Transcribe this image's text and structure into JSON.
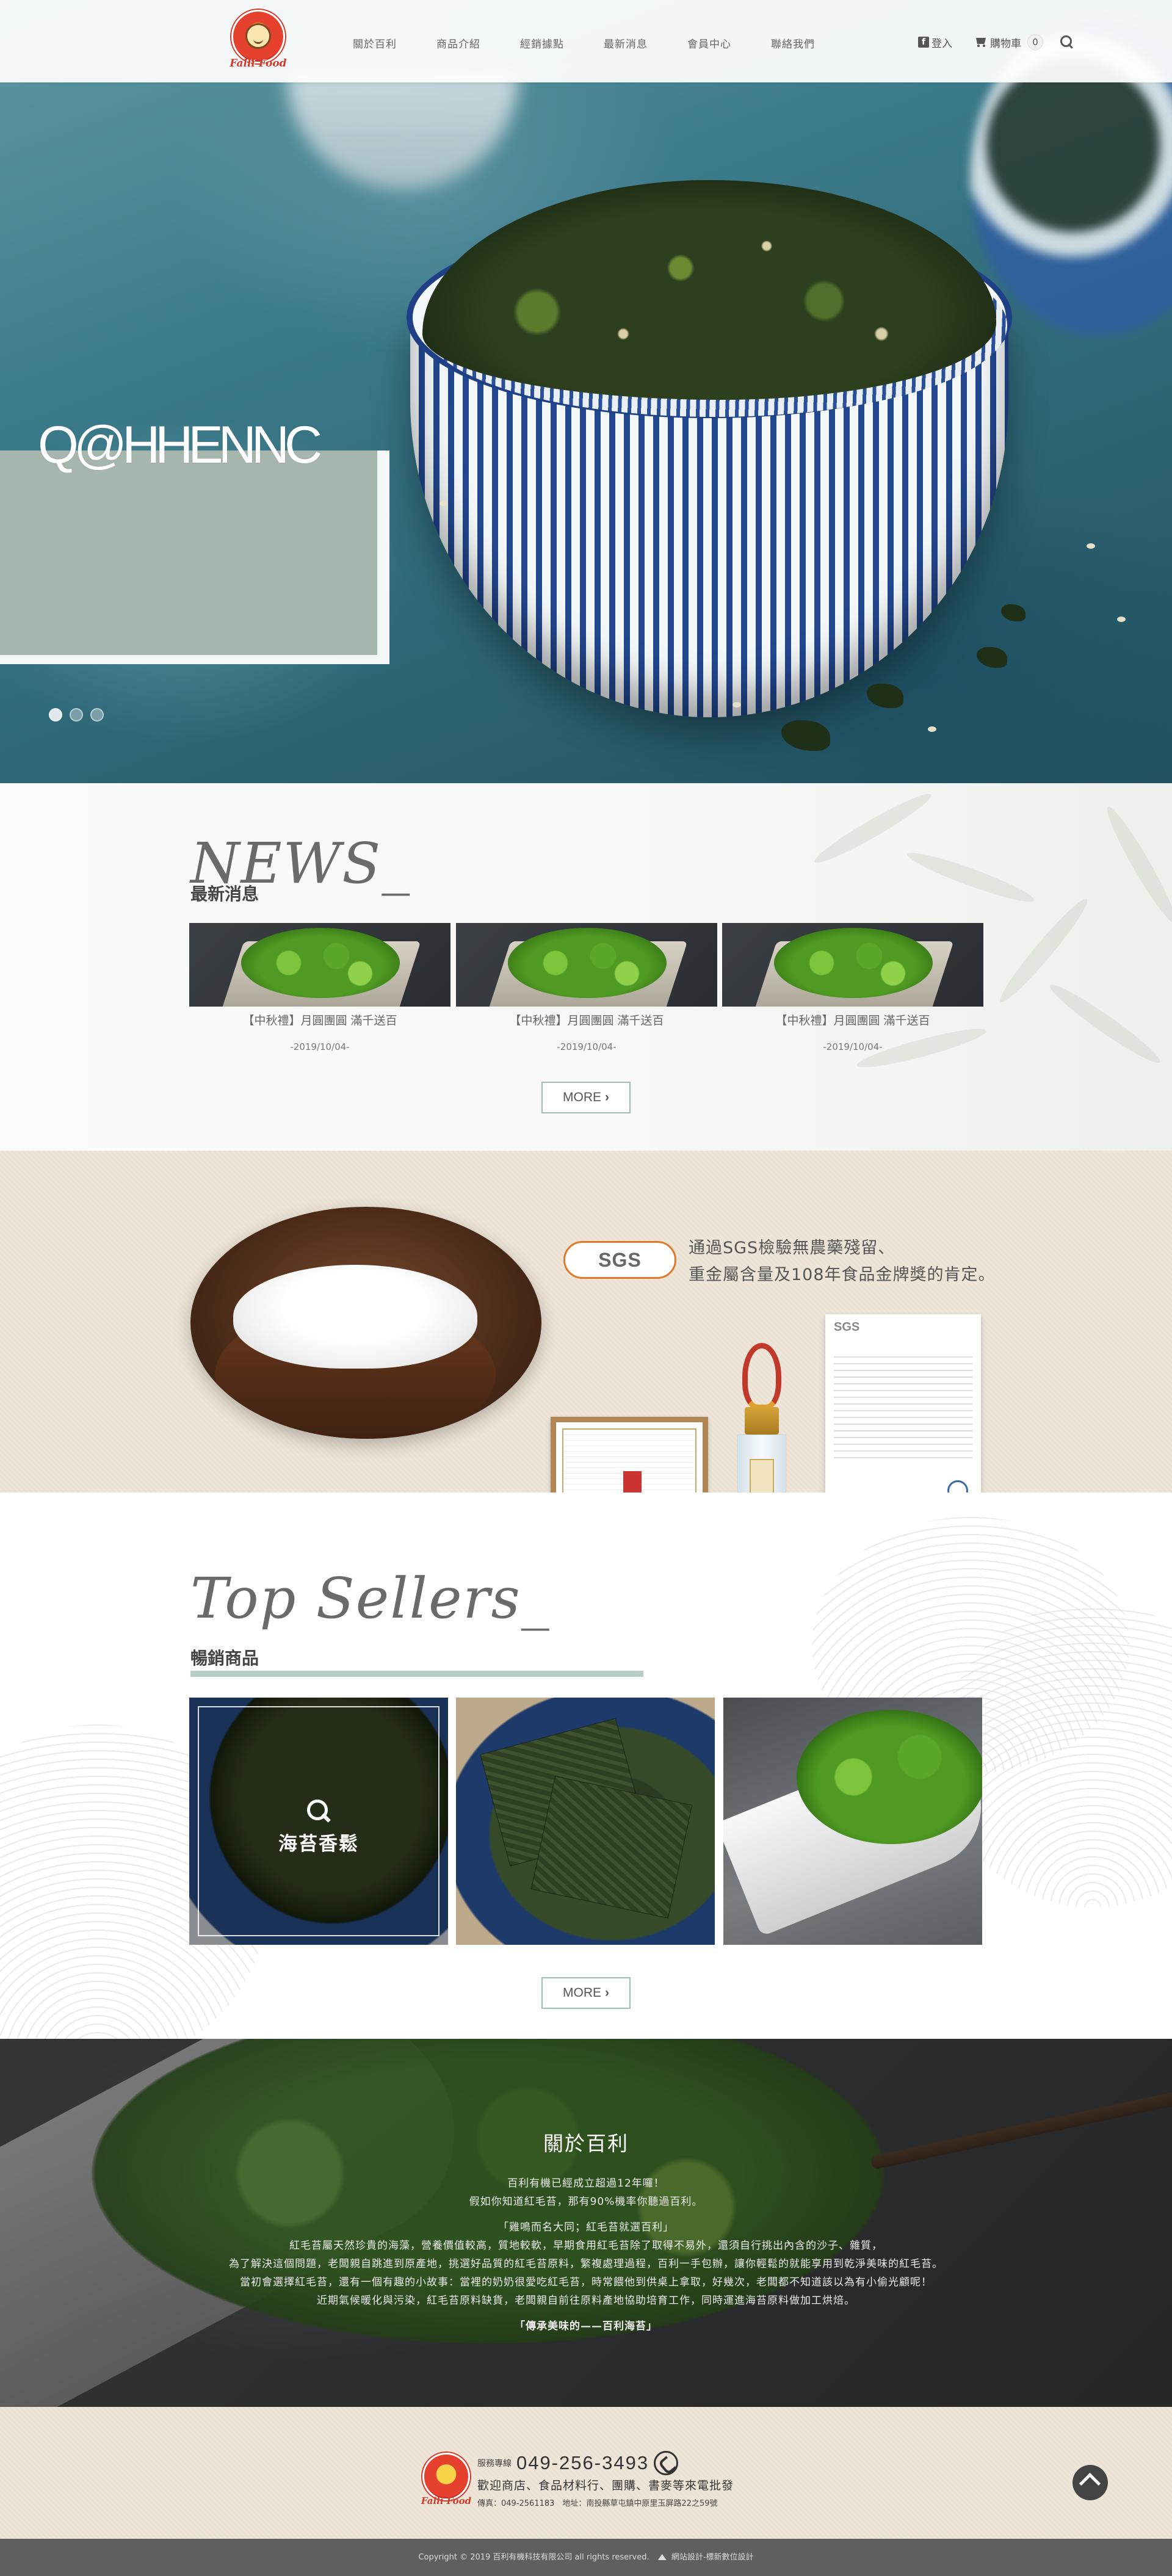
{
  "header": {
    "logo_text": "Falli Food",
    "nav": [
      "關於百利",
      "商品介紹",
      "經銷據點",
      "最新消息",
      "會員中心",
      "聯絡我們"
    ],
    "login_label": "登入",
    "cart_label": "購物車",
    "cart_count": "0",
    "icons": [
      "facebook-icon",
      "cart-icon",
      "search-icon"
    ]
  },
  "hero": {
    "title": "Q@HHENNC",
    "slide_count": 3,
    "active_slide": 1
  },
  "news": {
    "title": "NEWS_",
    "subtitle": "最新消息",
    "items": [
      {
        "caption": "【中秋禮】月圓團圓 滿千送百",
        "date": "-2019/10/04-"
      },
      {
        "caption": "【中秋禮】月圓團圓 滿千送百",
        "date": "-2019/10/04-"
      },
      {
        "caption": "【中秋禮】月圓團圓 滿千送百",
        "date": "-2019/10/04-"
      }
    ],
    "more_label": "MORE"
  },
  "sgs": {
    "badge": "SGS",
    "line1": "通過SGS檢驗無農藥殘留、",
    "line2": "重金屬含量及108年食品金牌獎的肯定。",
    "report_header": "SGS"
  },
  "sellers": {
    "title": "Top Sellers_",
    "subtitle": "暢銷商品",
    "products": [
      {
        "name": "海苔香鬆"
      }
    ],
    "more_label": "MORE"
  },
  "about": {
    "title": "關於百利",
    "p1": "百利有機已經成立超過12年囉！",
    "p2": "假如你知道紅毛苔，那有90%機率你聽過百利。",
    "p3": "「雞鳴而名大同；紅毛苔就選百利」",
    "p4": "紅毛苔屬天然珍貴的海藻，營養價值較高，質地較軟，早期食用紅毛苔除了取得不易外，還須自行挑出內含的沙子、雜質，",
    "p5": "為了解決這個問題，老闆親自跳進到原產地，挑選好品質的紅毛苔原料，繁複處理過程，百利一手包辦，讓你輕鬆的就能享用到乾淨美味的紅毛苔。",
    "p6": "當初會選擇紅毛苔，還有一個有趣的小故事：當裡的奶奶很愛吃紅毛苔，時常餵他到供桌上拿取，好幾次，老闆都不知道該以為有小偷光顧呢！",
    "p7": "近期氣候暖化與污染，紅毛苔原料缺貨，老闆親自前往原料產地協助培育工作，同時運進海苔原料做加工烘焙。",
    "p8": "「傳承美味的——百利海苔」"
  },
  "footer": {
    "service_label": "服務專線",
    "phone": "049-256-3493",
    "tagline": "歡迎商店、食品材料行、團購、書麥等來電批發",
    "fax_addr": "傳真：049-2561183　地址：南投縣草屯鎮中原里玉屏路22之59號",
    "copyright": "Copyright © 2019 百利有機科技有限公司 all rights reserved.",
    "designer": "網站設計-標新數位設計"
  },
  "colors": {
    "accent": "#9fbcb5",
    "sellers_bar": "#b8cdc7",
    "sgs_orange": "#e07a2a",
    "beige_bg": "#efe6d9",
    "logo_red": "#d23a2a"
  }
}
